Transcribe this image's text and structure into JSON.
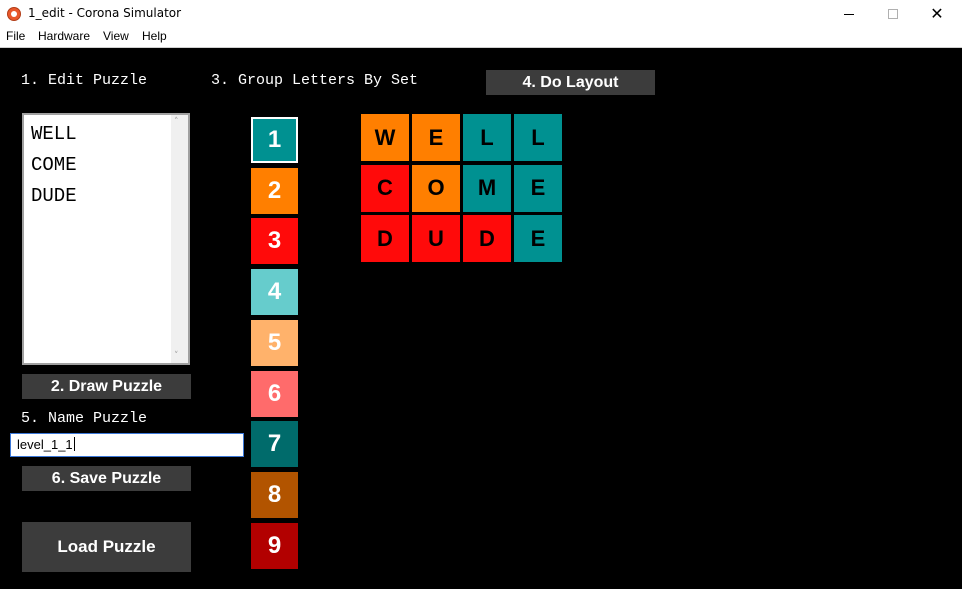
{
  "window": {
    "title": "1_edit - Corona Simulator",
    "app_icon": "corona-icon",
    "controls": {
      "minimize_icon": "minimize-icon",
      "maximize_icon": "maximize-icon",
      "close_glyph": "✕"
    }
  },
  "menu": [
    "File",
    "Hardware",
    "View",
    "Help"
  ],
  "labels": {
    "edit_puzzle": "1. Edit Puzzle",
    "group_letters": "3. Group Letters By Set",
    "name_puzzle": "5. Name Puzzle"
  },
  "buttons": {
    "draw_puzzle": "2. Draw Puzzle",
    "do_layout": "4. Do Layout",
    "save_puzzle": "6. Save Puzzle",
    "load_puzzle": "Load Puzzle"
  },
  "puzzle_text": [
    "WELL",
    "COME",
    "DUDE"
  ],
  "scroll": {
    "up": "˄",
    "down": "˅"
  },
  "puzzle_name": "level_1_1",
  "sets": [
    {
      "label": "1",
      "color": "#009191",
      "selected": true
    },
    {
      "label": "2",
      "color": "#ff7f00",
      "selected": false
    },
    {
      "label": "3",
      "color": "#ff0a0a",
      "selected": false
    },
    {
      "label": "4",
      "color": "#66cccc",
      "selected": false
    },
    {
      "label": "5",
      "color": "#ffb26b",
      "selected": false
    },
    {
      "label": "6",
      "color": "#ff6b6b",
      "selected": false
    },
    {
      "label": "7",
      "color": "#006b6b",
      "selected": false
    },
    {
      "label": "8",
      "color": "#b25400",
      "selected": false
    },
    {
      "label": "9",
      "color": "#b20000",
      "selected": false
    }
  ],
  "grid": [
    [
      {
        "letter": "W",
        "color": "#ff7f00"
      },
      {
        "letter": "E",
        "color": "#ff7f00"
      },
      {
        "letter": "L",
        "color": "#009191"
      },
      {
        "letter": "L",
        "color": "#009191"
      }
    ],
    [
      {
        "letter": "C",
        "color": "#ff0a0a"
      },
      {
        "letter": "O",
        "color": "#ff7f00"
      },
      {
        "letter": "M",
        "color": "#009191"
      },
      {
        "letter": "E",
        "color": "#009191"
      }
    ],
    [
      {
        "letter": "D",
        "color": "#ff0a0a"
      },
      {
        "letter": "U",
        "color": "#ff0a0a"
      },
      {
        "letter": "D",
        "color": "#ff0a0a"
      },
      {
        "letter": "E",
        "color": "#009191"
      }
    ]
  ]
}
